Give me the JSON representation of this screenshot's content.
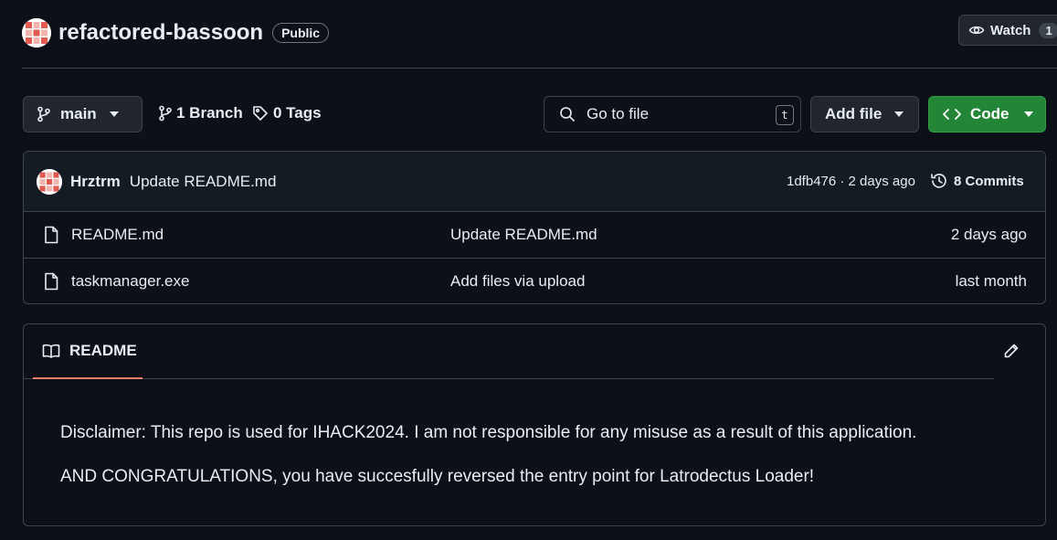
{
  "repo": {
    "name": "refactored-bassoon",
    "visibility": "Public",
    "watch_label": "Watch",
    "watch_count": "1"
  },
  "toolbar": {
    "branch": "main",
    "branches": "1 Branch",
    "tags": "0 Tags",
    "goto_placeholder": "Go to file",
    "goto_shortcut": "t",
    "add_file": "Add file",
    "code": "Code"
  },
  "latest_commit": {
    "author": "Hrztrm",
    "message": "Update README.md",
    "meta": "1dfb476 · 2 days ago",
    "commits": "8 Commits"
  },
  "files": [
    {
      "name": "README.md",
      "commit": "Update README.md",
      "date": "2 days ago"
    },
    {
      "name": "taskmanager.exe",
      "commit": "Add files via upload",
      "date": "last month"
    }
  ],
  "readme": {
    "tab": "README",
    "lines": [
      "Disclaimer: This repo is used for IHACK2024. I am not responsible for any misuse as a result of this application.",
      "AND CONGRATULATIONS, you have succesfully reversed the entry point for Latrodectus Loader!"
    ]
  },
  "colors": {
    "background": "#0d1117",
    "border": "#3d444d",
    "code_button": "#238636",
    "tab_underline": "#f78166"
  }
}
